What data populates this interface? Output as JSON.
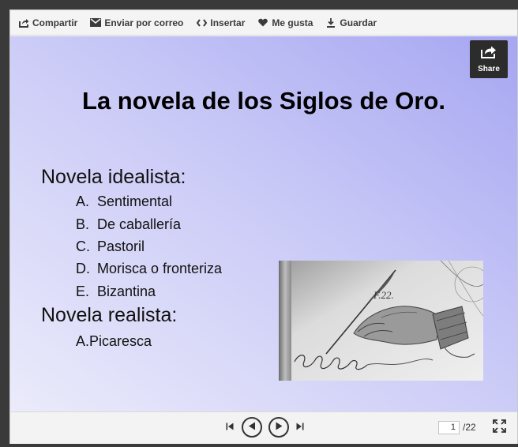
{
  "toolbar": {
    "items": [
      {
        "label": "Compartir",
        "icon": "share-arrow-icon"
      },
      {
        "label": "Enviar por correo",
        "icon": "envelope-icon"
      },
      {
        "label": "Insertar",
        "icon": "code-icon"
      },
      {
        "label": "Me gusta",
        "icon": "heart-icon"
      },
      {
        "label": "Guardar",
        "icon": "download-icon"
      }
    ]
  },
  "slide": {
    "share_label": "Share",
    "title": "La novela de los Siglos de Oro.",
    "sections": [
      {
        "heading": "Novela idealista:",
        "items": [
          {
            "letter": "A.",
            "text": "Sentimental"
          },
          {
            "letter": "B.",
            "text": "De caballería"
          },
          {
            "letter": "C.",
            "text": "Pastoril"
          },
          {
            "letter": "D.",
            "text": "Morisca o fronteriza"
          },
          {
            "letter": "E.",
            "text": "Bizantina"
          }
        ]
      },
      {
        "heading": "Novela realista:",
        "items": [
          {
            "text": "A.Picaresca"
          }
        ]
      }
    ],
    "illustration_caption": "F.22."
  },
  "navigation": {
    "current_page": "1",
    "total_pages": "/22"
  },
  "colors": {
    "slide_gradient_top": "#a6a6f2",
    "slide_gradient_bottom": "#ebebfb",
    "share_button_bg": "#2c2c2c"
  }
}
